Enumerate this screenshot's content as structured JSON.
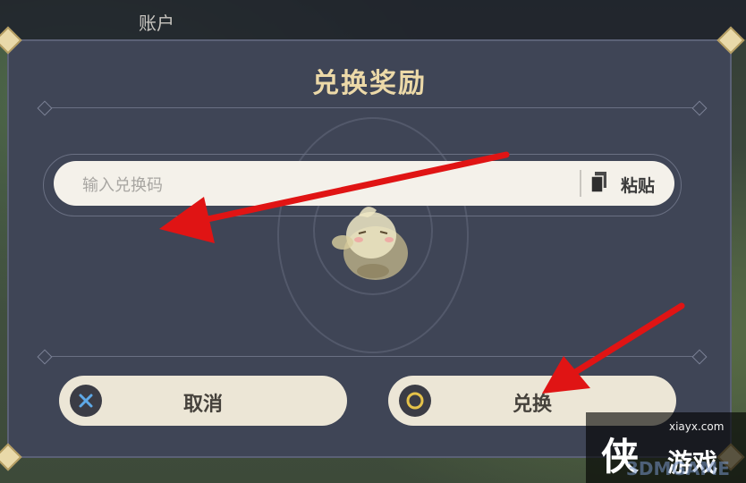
{
  "header": {
    "account_label": "账户"
  },
  "dialog": {
    "title": "兑换奖励",
    "input": {
      "placeholder": "输入兑换码"
    },
    "paste_label": "粘贴",
    "cancel_label": "取消",
    "confirm_label": "兑换"
  },
  "watermark": {
    "url": "xiayx.com",
    "big_char": "侠",
    "text": "游戏",
    "brand_faint": "3DMGAME"
  },
  "colors": {
    "title_gold": "#ecd9a8",
    "dialog_bg": "#3f4556",
    "button_bg": "#ece6d6",
    "arrow_red": "#e01414"
  },
  "icons": {
    "cancel_icon": "x-circle-icon",
    "confirm_icon": "circle-icon",
    "paste_icon": "clipboard-icon"
  }
}
